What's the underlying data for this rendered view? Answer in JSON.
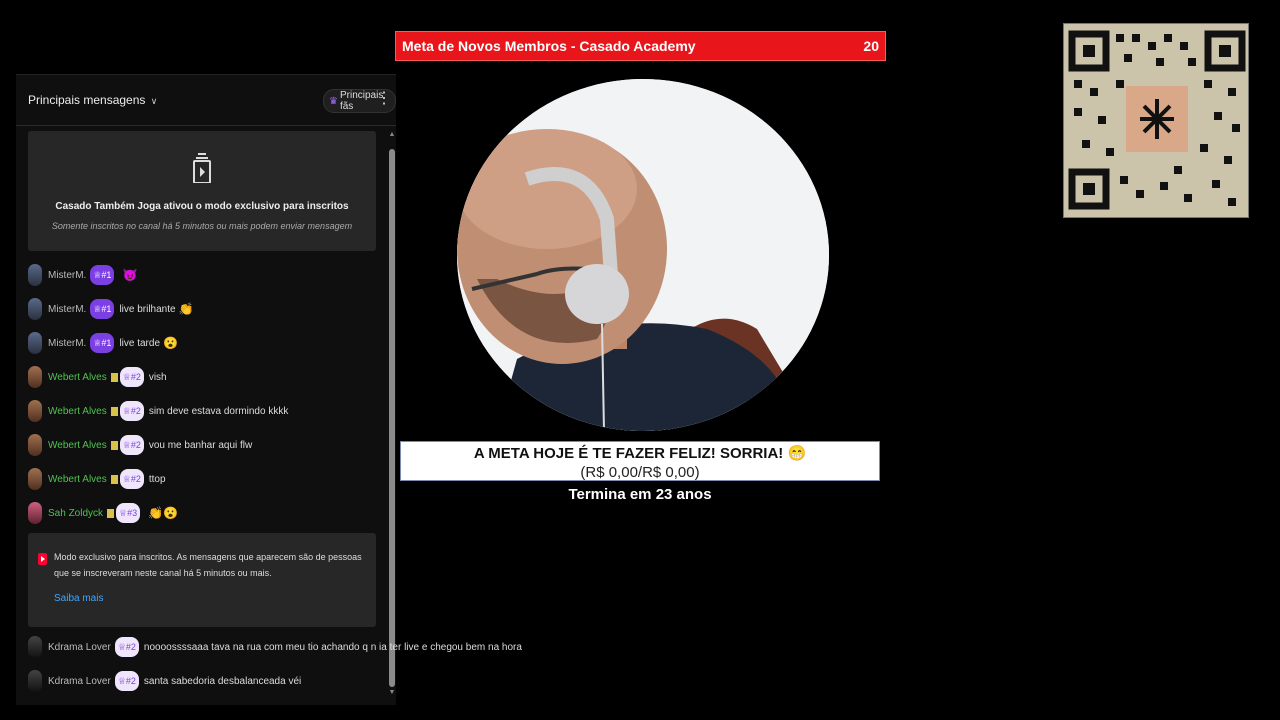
{
  "chat": {
    "title": "Principais mensagens",
    "title_chevron": "∨",
    "fans_button": "Principais fãs",
    "fans_icon": "crown-icon",
    "menu_icon": "kebab-icon",
    "notice": {
      "icon": "subscribers-only-icon",
      "line1": "Casado Também Joga ativou o modo exclusivo para inscritos",
      "line2": "Somente inscritos no canal há 5 minutos ou mais podem enviar mensagem"
    },
    "messages": [
      {
        "author": "MisterM.",
        "badge": "#1",
        "text": "",
        "emoji": "😈"
      },
      {
        "author": "MisterM.",
        "badge": "#1",
        "text": "live brilhante",
        "emoji": "👏"
      },
      {
        "author": "MisterM.",
        "badge": "#1",
        "text": "live tarde",
        "emoji": "😮"
      },
      {
        "author": "Webert Alves",
        "badge": "#2",
        "text": "vish",
        "emoji": ""
      },
      {
        "author": "Webert Alves",
        "badge": "#2",
        "text": "sim deve estava dormindo kkkk",
        "emoji": ""
      },
      {
        "author": "Webert Alves",
        "badge": "#2",
        "text": "vou me banhar aqui flw",
        "emoji": ""
      },
      {
        "author": "Webert Alves",
        "badge": "#2",
        "text": "ttop",
        "emoji": ""
      },
      {
        "author": "Sah Zoldyck",
        "badge": "#3",
        "text": "",
        "emoji": "👏😮"
      }
    ],
    "info": {
      "text": "Modo exclusivo para inscritos. As mensagens que aparecem são de pessoas que se inscreveram neste canal há 5 minutos ou mais.",
      "link": "Saiba mais"
    },
    "later_messages": [
      {
        "author": "Kdrama Lover",
        "badge": "#2",
        "text": "noooossssaaa tava na rua com meu tio achando q n ia ter live e chegou bem na hora"
      },
      {
        "author": "Kdrama Lover",
        "badge": "#2",
        "text": "santa sabedoria desbalanceada véi"
      }
    ]
  },
  "overlay": {
    "goal_title": "Meta de Novos Membros - Casado Academy",
    "goal_count": "20",
    "meta_line1": "A META HOJE É TE FAZER FELIZ! SORRIA! 😁",
    "meta_line2": "(R$ 0,00/R$ 0,00)",
    "ends_in": "Termina em 23 anos"
  },
  "qr": {
    "icon": "qr-code"
  }
}
